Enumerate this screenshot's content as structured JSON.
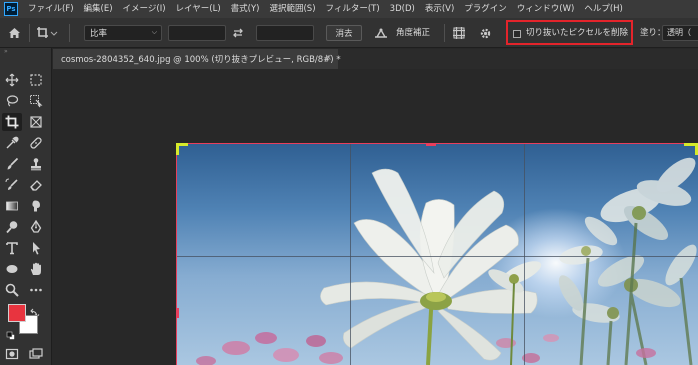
{
  "app": {
    "logo_text": "Ps"
  },
  "menu": [
    "ファイル(F)",
    "編集(E)",
    "イメージ(I)",
    "レイヤー(L)",
    "書式(Y)",
    "選択範囲(S)",
    "フィルター(T)",
    "3D(D)",
    "表示(V)",
    "プラグイン",
    "ウィンドウ(W)",
    "ヘルプ(H)"
  ],
  "options": {
    "ratio_value": "比率",
    "clear_label": "消去",
    "straighten_label": "角度補正",
    "delete_cropped_pixels_label": "切り抜いたピクセルを削除",
    "delete_cropped_pixels_checked": false,
    "fill_label": "塗り：",
    "fill_value": "透明（",
    "highlight_color": "#e4242b"
  },
  "document": {
    "tab_title": "cosmos-2804352_640.jpg @ 100% (切り抜きプレビュー, RGB/8#) *",
    "close_symbol": "×"
  },
  "colors": {
    "foreground": "#e8343f",
    "background": "#ffffff",
    "crop_edge": "#e83e5c",
    "crop_corner": "#d6ea2b"
  }
}
